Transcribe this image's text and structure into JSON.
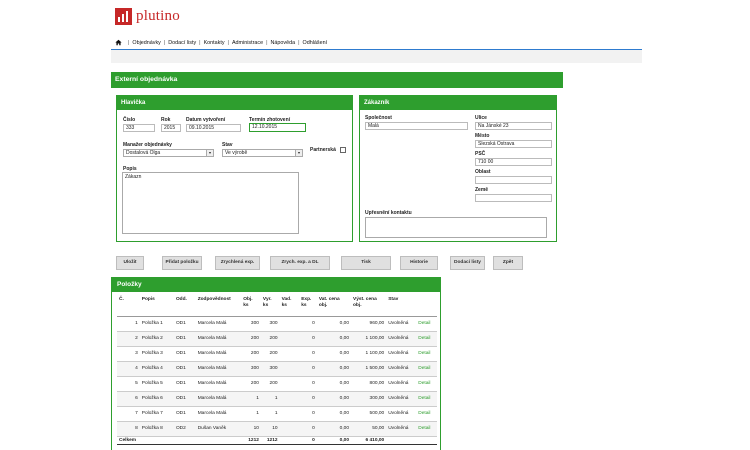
{
  "logo": {
    "text": "plutino"
  },
  "nav": {
    "items": [
      "Objednávky",
      "Dodací listy",
      "Kontakty",
      "Administrace",
      "Nápověda",
      "Odhlášení"
    ]
  },
  "page": {
    "title": "Externí objednávka"
  },
  "header_section": {
    "title": "Hlavička",
    "cislo_label": "Číslo",
    "cislo": "333",
    "rok_label": "Rok",
    "rok": "2015",
    "datum_label": "Datum vytvoření",
    "datum": "09.10.2015",
    "termin_label": "Termín zhotovení",
    "termin": "12.10.2015",
    "manazer_label": "Manažer objednávky",
    "manazer": "Dostalová Olga",
    "stav_label": "Stav",
    "stav": "Ve výrobě",
    "partnerska_label": "Partnerská",
    "popis_label": "Popis",
    "popis": "Zákazn"
  },
  "customer_section": {
    "title": "Zákazník",
    "spolecnost_label": "Společnost",
    "spolecnost": "Malá",
    "ulice_label": "Ulice",
    "ulice": "Na Jánské 23",
    "mesto_label": "Město",
    "mesto": "Slezská Ostrava",
    "psc_label": "PSČ",
    "psc": "710 00",
    "oblast_label": "Oblast",
    "oblast": "",
    "zeme_label": "Země",
    "zeme": "",
    "upresneni_label": "Upřesnění kontaktu"
  },
  "buttons": {
    "ulozit": "Uložit",
    "pridat": "Přidat položku",
    "zrychlena": "Zrychlená exp.",
    "zrych_dl": "Zrych. exp. a DL",
    "tisk": "Tisk",
    "historie": "Historie",
    "dodaci": "Dodací listy",
    "zpet": "Zpět"
  },
  "items": {
    "title": "Položky",
    "columns": [
      "Č.",
      "Popis",
      "Odd.",
      "Zodpovědnost",
      "Obj. ks",
      "Vyr. ks",
      "Vad. ks",
      "Exp. ks",
      "Vat. cena obj.",
      "Výst. cena obj.",
      "Stav",
      ""
    ],
    "rows": [
      [
        "1",
        "Položka 1",
        "OD1",
        "Marcela Malá",
        "300",
        "300",
        "",
        "0",
        "0,00",
        "960,00",
        "Uvolněná",
        "Detail"
      ],
      [
        "2",
        "Položka 2",
        "OD1",
        "Marcela Malá",
        "200",
        "200",
        "",
        "0",
        "0,00",
        "1 100,00",
        "Uvolněná",
        "Detail"
      ],
      [
        "3",
        "Položka 3",
        "OD1",
        "Marcela Malá",
        "200",
        "200",
        "",
        "0",
        "0,00",
        "1 100,00",
        "Uvolněná",
        "Detail"
      ],
      [
        "4",
        "Položka 4",
        "OD1",
        "Marcela Malá",
        "300",
        "300",
        "",
        "0",
        "0,00",
        "1 500,00",
        "Uvolněná",
        "Detail"
      ],
      [
        "5",
        "Položka 5",
        "OD1",
        "Marcela Malá",
        "200",
        "200",
        "",
        "0",
        "0,00",
        "800,00",
        "Uvolněná",
        "Detail"
      ],
      [
        "6",
        "Položka 6",
        "OD1",
        "Marcela Malá",
        "1",
        "1",
        "",
        "0",
        "0,00",
        "300,00",
        "Uvolněná",
        "Detail"
      ],
      [
        "7",
        "Položka 7",
        "OD1",
        "Marcela Malá",
        "1",
        "1",
        "",
        "0",
        "0,00",
        "500,00",
        "Uvolněná",
        "Detail"
      ],
      [
        "8",
        "Položka 8",
        "OD2",
        "Dušan Vaněk",
        "10",
        "10",
        "",
        "0",
        "0,00",
        "50,00",
        "Uvolněná",
        "Detail"
      ]
    ],
    "total": [
      "Celkem",
      "",
      "",
      "",
      "1212",
      "1212",
      "",
      "0",
      "0,00",
      "6 410,00",
      "",
      ""
    ]
  }
}
